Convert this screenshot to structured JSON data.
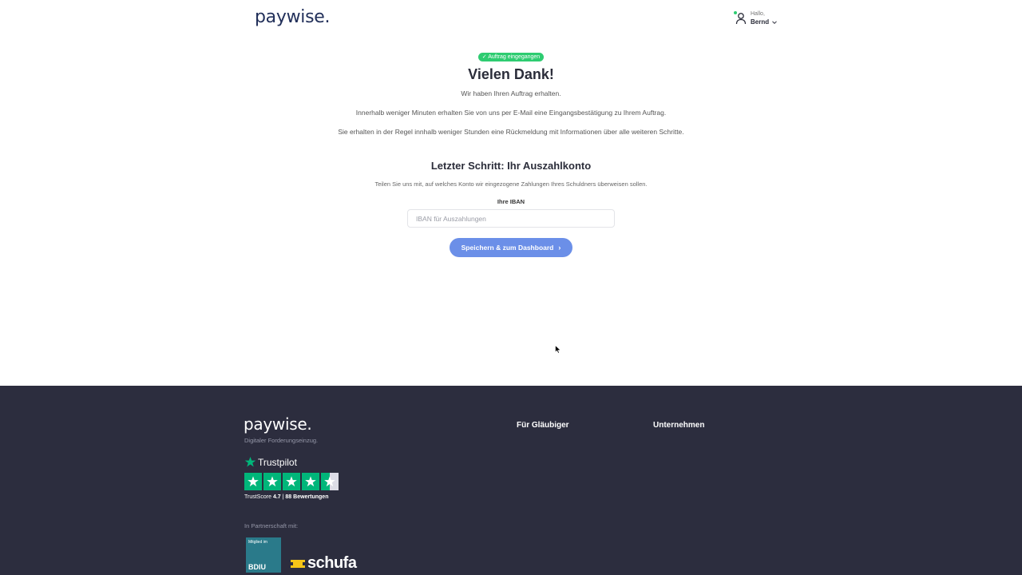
{
  "header": {
    "logo": "paywise.",
    "greeting": "Hallo,",
    "user_name": "Bernd"
  },
  "main": {
    "badge": "✓ Auftrag eingegangen",
    "title": "Vielen Dank!",
    "line1": "Wir haben Ihren Auftrag erhalten.",
    "line2": "Innerhalb weniger Minuten erhalten Sie von uns per E-Mail eine Eingangsbestätigung zu Ihrem Auftrag.",
    "line3": "Sie erhalten in der Regel innhalb weniger Stunden eine Rückmeldung mit Informationen über alle weiteren Schritte.",
    "subtitle": "Letzter Schritt: Ihr Auszahlkonto",
    "instruction": "Teilen Sie uns mit, auf welches Konto wir eingezogene Zahlungen Ihres Schuldners überweisen sollen.",
    "iban_label": "Ihre IBAN",
    "iban_placeholder": "IBAN für Auszahlungen",
    "iban_value": "",
    "save_button": "Speichern & zum Dashboard",
    "save_arrow": "›"
  },
  "footer": {
    "logo": "paywise.",
    "tagline": "Digitaler Forderungseinzug.",
    "trustpilot_name": "Trustpilot",
    "trustscore_label": "TrustScore",
    "trustscore_value": "4.7",
    "separator": "|",
    "reviews": "88 Bewertungen",
    "trustpilot_rating_stars": 4.5,
    "partner_label": "In Partnerschaft mit:",
    "bdiu_top": "Mitglied im",
    "bdiu_name": "BDIU",
    "schufa": "schufa",
    "col1": "Für Gläubiger",
    "col2": "Unternehmen"
  },
  "colors": {
    "brand_dark": "#22305a",
    "success": "#2ecc71",
    "button": "#6b8fe8",
    "footer_bg": "#2c2d3e",
    "trustpilot_green": "#00b67a",
    "schufa_yellow": "#f5c518"
  }
}
